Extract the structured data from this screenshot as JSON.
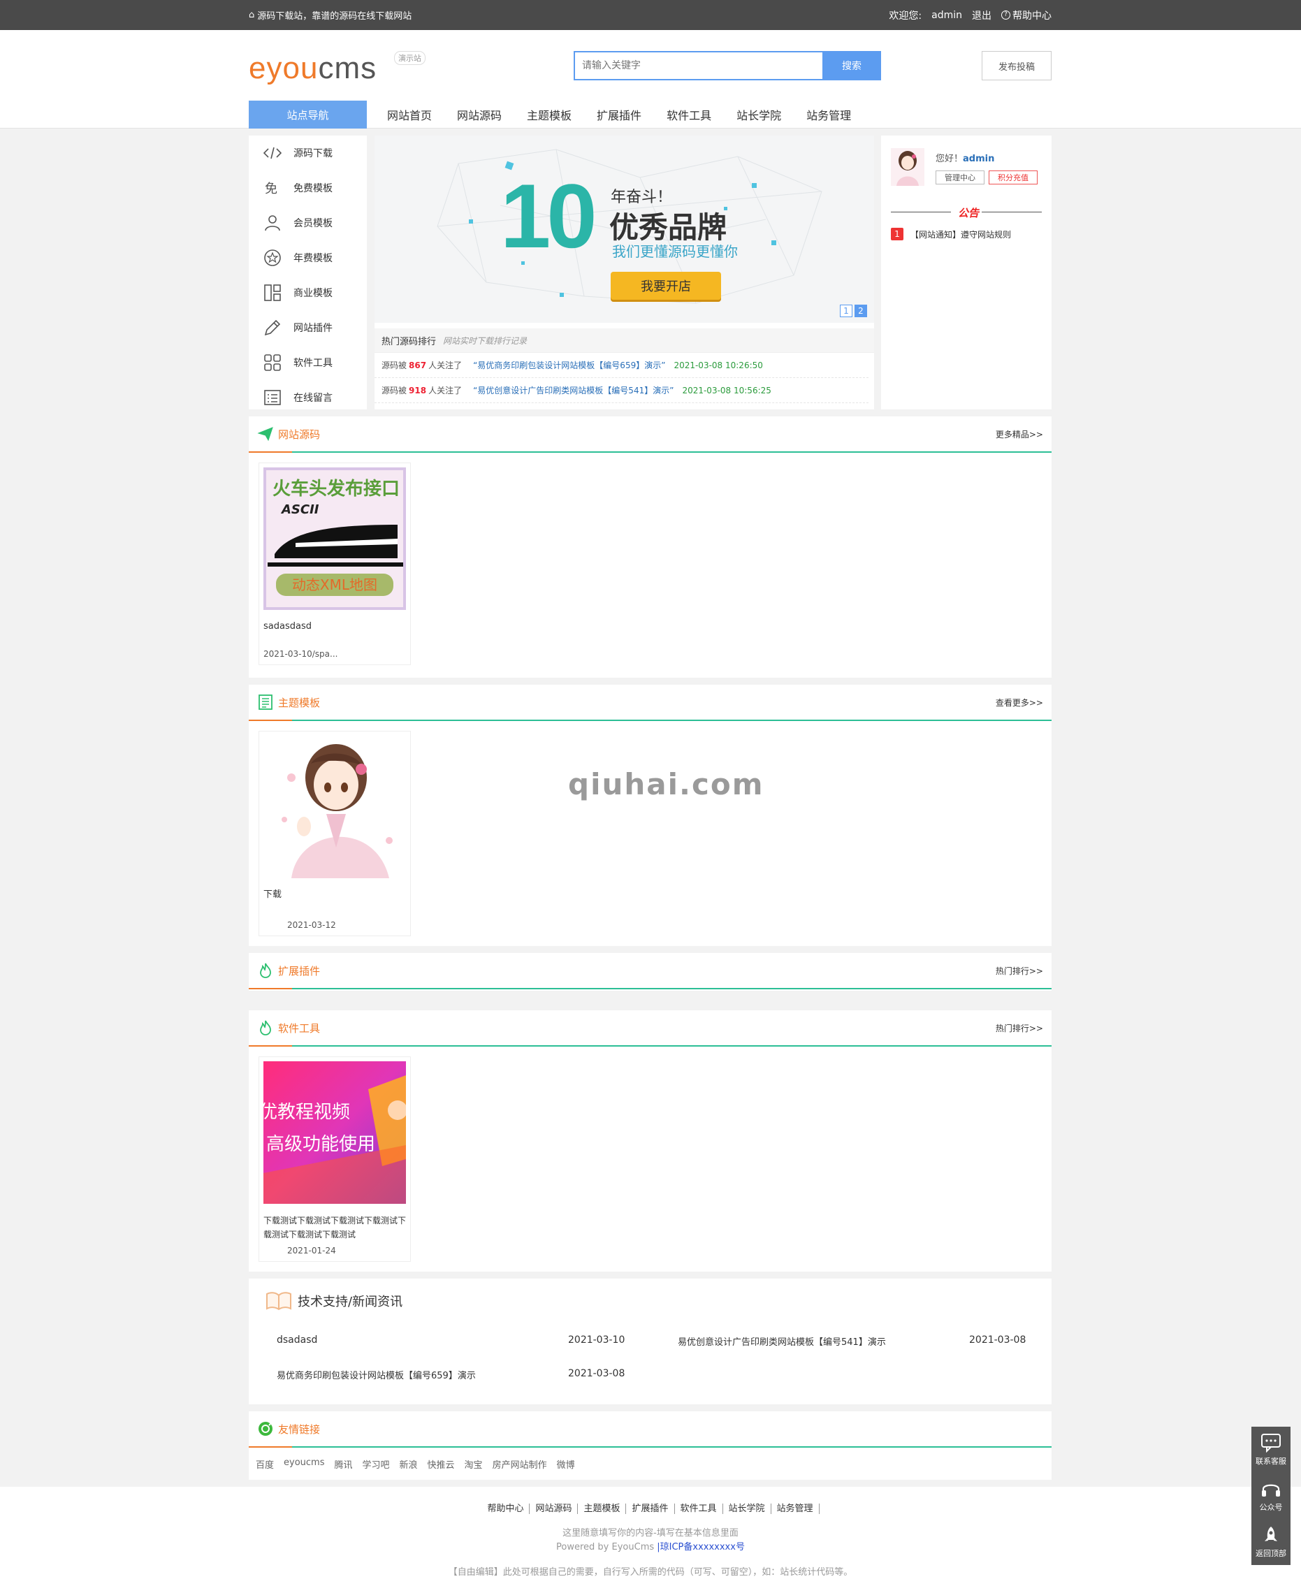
{
  "topbar": {
    "slogan": "源码下载站，靠谱的源码在线下载网站",
    "welcome": "欢迎您:",
    "user": "admin",
    "logout": "退出",
    "help": "帮助中心"
  },
  "header": {
    "logo_e": "e",
    "logo_you": "you",
    "logo_cms": "cms",
    "logo_tag": "演示站",
    "search_placeholder": "请输入关键字",
    "search_button": "搜索",
    "publish": "发布投稿"
  },
  "nav": {
    "side_title": "站点导航",
    "items": [
      "网站首页",
      "网站源码",
      "主题模板",
      "扩展插件",
      "软件工具",
      "站长学院",
      "站务管理"
    ]
  },
  "sidemenu": [
    "源码下载",
    "免费模板",
    "会员模板",
    "年费模板",
    "商业模板",
    "网站插件",
    "软件工具",
    "在线留言"
  ],
  "banner": {
    "big_num": "10",
    "line1": "年奋斗！",
    "line2": "优秀品牌",
    "line3": "我们更懂源码更懂你",
    "button": "我要开店",
    "pages": [
      "1",
      "2"
    ]
  },
  "hot": {
    "title": "热门源码排行",
    "subtitle": "网站实时下载排行记录",
    "items": [
      {
        "prefix": "源码被",
        "num": "867",
        "suffix": "人关注了",
        "title": "“易优商务印刷包装设计网站模板【编号659】演示”",
        "date": "2021-03-08 10:26:50"
      },
      {
        "prefix": "源码被",
        "num": "918",
        "suffix": "人关注了",
        "title": "“易优创意设计广告印刷类网站模板【编号541】演示”",
        "date": "2021-03-08 10:56:25"
      }
    ]
  },
  "user": {
    "hello": "您好！",
    "name": "admin",
    "btn_center": "管理中心",
    "btn_recharge": "积分充值",
    "notice_title": "公告",
    "notice_num": "1",
    "notice_text": "【网站通知】遵守网站规则"
  },
  "sections": {
    "source": {
      "title": "网站源码",
      "more": "更多精品>>",
      "card_name": "sadasdasd",
      "card_date": "2021-03-10/spa...",
      "img_text_top": "火车头发布接口",
      "img_text_ascii": "ASCII",
      "img_text_bottom": "动态XML地图"
    },
    "theme": {
      "title": "主题模板",
      "more": "查看更多>>",
      "card_name": "下载",
      "card_date": "2021-03-12"
    },
    "plugin": {
      "title": "扩展插件",
      "more": "热门排行>>"
    },
    "tools": {
      "title": "软件工具",
      "more": "热门排行>>",
      "card_name": "下载测试下载测试下载测试下载测试下载测试下载测试下载测试",
      "card_date": "2021-01-24",
      "img_line1": "优教程视频",
      "img_line2": "高级功能使用"
    }
  },
  "news": {
    "title": "技术支持/新闻资讯",
    "items": [
      {
        "title": "dsadasd",
        "date": "2021-03-10"
      },
      {
        "title": "易优创意设计广告印刷类网站模板【编号541】演示",
        "date": "2021-03-08"
      },
      {
        "title": "易优商务印刷包装设计网站模板【编号659】演示",
        "date": "2021-03-08"
      }
    ]
  },
  "friends": {
    "title": "友情链接",
    "items": [
      "百度",
      "eyoucms",
      "腾讯",
      "学习吧",
      "新浪",
      "快推云",
      "淘宝",
      "房产网站制作",
      "微博"
    ]
  },
  "footer": {
    "links": [
      "帮助中心",
      "网站源码",
      "主题模板",
      "扩展插件",
      "软件工具",
      "站长学院",
      "站务管理"
    ],
    "line1": "这里随意填写你的内容-填写在基本信息里面",
    "powered": "Powered by EyouCms",
    "icp": "|琼ICP备xxxxxxxx号",
    "line3": "【自由编辑】此处可根据自己的需要，自行写入所需的代码（可写、可留空），如：站长统计代码等。"
  },
  "floatbar": [
    "联系客服",
    "公众号",
    "返回顶部"
  ],
  "watermark": "qiuhai.com",
  "colors": {
    "accent_blue": "#5c9cf0",
    "accent_orange": "#ef7a2a",
    "accent_green": "#2cbf96",
    "topbar": "#4a4a4a"
  }
}
